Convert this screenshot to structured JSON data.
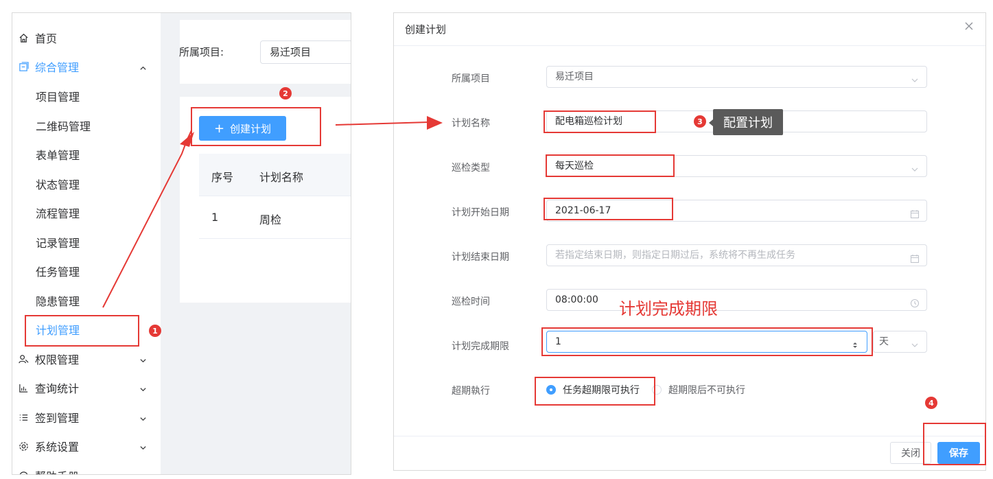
{
  "sidebar": {
    "home": "首页",
    "integrated": "综合管理",
    "sub_items": [
      "项目管理",
      "二维码管理",
      "表单管理",
      "状态管理",
      "流程管理",
      "记录管理",
      "任务管理",
      "隐患管理",
      "计划管理"
    ],
    "permission": "权限管理",
    "query_stats": "查询统计",
    "checkin": "签到管理",
    "system": "系统设置",
    "help": "帮助手册"
  },
  "filter": {
    "label": "所属项目:",
    "value": "易迁项目"
  },
  "toolbar": {
    "create_plus": "+",
    "create_label": "创建计划"
  },
  "table": {
    "headers": [
      "序号",
      "计划名称"
    ],
    "rows": [
      {
        "no": "1",
        "name": "周检"
      }
    ]
  },
  "dialog": {
    "title": "创建计划",
    "fields": {
      "project": {
        "label": "所属项目",
        "value": "易迁项目"
      },
      "plan_name": {
        "label": "计划名称",
        "value": "配电箱巡检计划"
      },
      "inspect_type": {
        "label": "巡检类型",
        "value": "每天巡检"
      },
      "start_date": {
        "label": "计划开始日期",
        "value": "2021-06-17"
      },
      "end_date": {
        "label": "计划结束日期",
        "placeholder": "若指定结束日期，则指定日期过后，系统将不再生成任务"
      },
      "inspect_time": {
        "label": "巡检时间",
        "value": "08:00:00"
      },
      "deadline": {
        "label": "计划完成期限",
        "value": "1",
        "unit": "天"
      },
      "overdue": {
        "label": "超期執行",
        "option_allowed": "任务超期限可执行",
        "option_denied": "超期限后不可执行"
      }
    },
    "close_label": "关闭",
    "save_label": "保存"
  },
  "annotations": {
    "badges": [
      "1",
      "2",
      "3",
      "4"
    ],
    "tooltip_config": "配置计划",
    "caption_deadline": "计划完成期限"
  },
  "colors": {
    "primary": "#409eff",
    "annotation": "#e53935"
  }
}
